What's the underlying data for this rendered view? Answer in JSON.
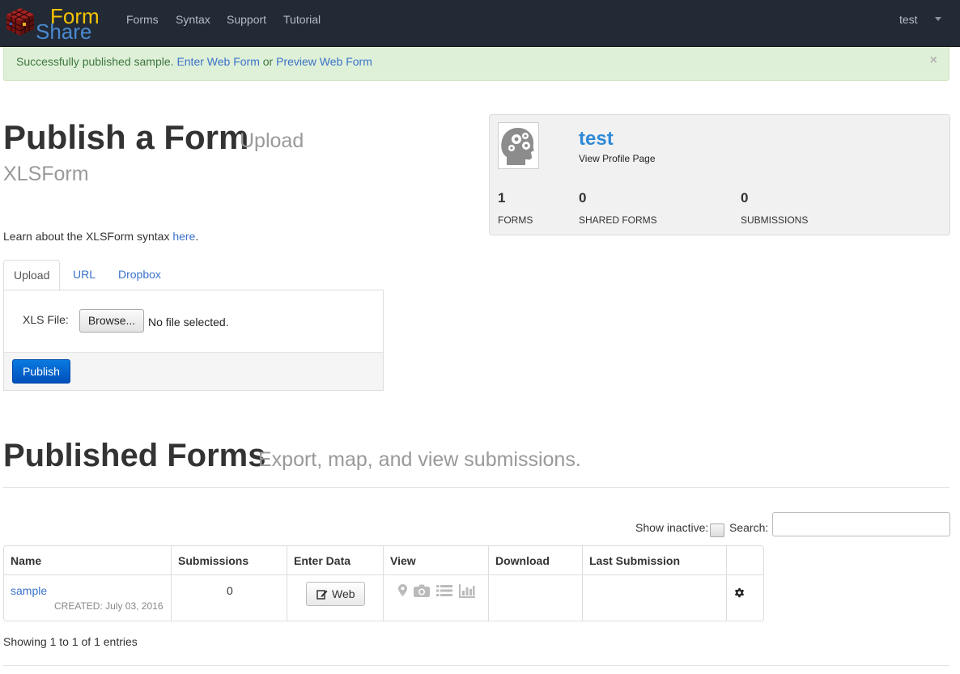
{
  "navbar": {
    "brand_top": "Form",
    "brand_bottom": "Share",
    "links": [
      "Forms",
      "Syntax",
      "Support",
      "Tutorial"
    ],
    "user": "test"
  },
  "alert": {
    "message": "Successfully published sample.",
    "link1": "Enter Web Form",
    "connector": "or",
    "link2": "Preview Web Form",
    "close": "×"
  },
  "publish": {
    "title": "Publish a Form",
    "subtitle_line1": "Upload",
    "subtitle_line2": "XLSForm",
    "learn_prefix": "Learn about the XLSForm syntax",
    "learn_link": "here",
    "learn_suffix": ".",
    "tabs": [
      "Upload",
      "URL",
      "Dropbox"
    ],
    "xls_label": "XLS File:",
    "browse_label": "Browse...",
    "no_file": "No file selected.",
    "publish_label": "Publish"
  },
  "profile": {
    "name": "test",
    "link": "View Profile Page",
    "stats": [
      {
        "value": "1",
        "label": "FORMS"
      },
      {
        "value": "0",
        "label": "SHARED FORMS"
      },
      {
        "value": "0",
        "label": "SUBMISSIONS"
      }
    ]
  },
  "published": {
    "title": "Published Forms",
    "subtitle": "Export, map, and view submissions.",
    "show_inactive": "Show inactive:",
    "search_label": "Search:",
    "search_value": "",
    "columns": [
      "Name",
      "Submissions",
      "Enter Data",
      "View",
      "Download",
      "Last Submission"
    ],
    "rows": [
      {
        "name": "sample",
        "created": "CREATED: July 03, 2016",
        "submissions": "0",
        "enter_data": "Web"
      }
    ],
    "footer": "Showing 1 to 1 of 1 entries"
  },
  "icons": [
    "cube-logo-icon",
    "caret-down-icon",
    "avatar-head-gears-icon",
    "edit-icon",
    "map-marker-icon",
    "camera-icon",
    "list-icon",
    "chart-icon",
    "gear-icon"
  ],
  "colors": {
    "navbar_bg": "#222a36",
    "brand_yellow": "#f5c400",
    "brand_blue": "#4a8ad0",
    "alert_bg": "#dff0d8",
    "link": "#3a72c8",
    "primary_btn": "#0a6fd8"
  }
}
